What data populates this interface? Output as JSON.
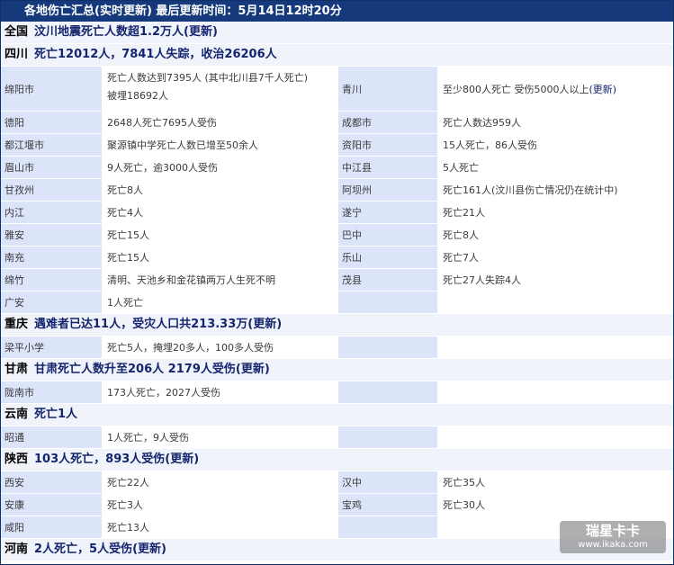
{
  "title": "各地伤亡汇总(实时更新) 最后更新时间：5月14日12时20分",
  "update_label": "(更新)",
  "sections": [
    {
      "province": "全国",
      "headline": "汶川地震死亡人数超1.2万人",
      "has_update": true,
      "rows": []
    },
    {
      "province": "四川",
      "headline": "死亡12012人，7841人失踪，收治26206人",
      "has_update": false,
      "rows": [
        {
          "l1": "绵阳市",
          "v1": "死亡人数达到7395人 (其中北川县7千人死亡)\n被埋18692人",
          "l2": "青川",
          "v2": "至少800人死亡 受伤5000人以上",
          "v2_update": "(更新)",
          "tall": true
        },
        {
          "l1": "德阳",
          "v1": "2648人死亡7695人受伤",
          "l2": "成都市",
          "v2": "死亡人数达959人"
        },
        {
          "l1": "都江堰市",
          "v1": "聚源镇中学死亡人数已增至50余人",
          "l2": "资阳市",
          "v2": "15人死亡，86人受伤"
        },
        {
          "l1": "眉山市",
          "v1": "9人死亡，逾3000人受伤",
          "l2": "中江县",
          "v2": "5人死亡"
        },
        {
          "l1": "甘孜州",
          "v1": "死亡8人",
          "l2": "阿坝州",
          "v2": "死亡161人(汶川县伤亡情况仍在统计中)"
        },
        {
          "l1": "内江",
          "v1": "死亡4人",
          "l2": "遂宁",
          "v2": "死亡21人"
        },
        {
          "l1": "雅安",
          "v1": "死亡15人",
          "l2": "巴中",
          "v2": "死亡8人"
        },
        {
          "l1": "南充",
          "v1": "死亡15人",
          "l2": "乐山",
          "v2": "死亡7人"
        },
        {
          "l1": "绵竹",
          "v1": "清明、天池乡和金花镇两万人生死不明",
          "l2": "茂县",
          "v2": "死亡27人失踪4人"
        },
        {
          "l1": "广安",
          "v1": "1人死亡",
          "l2": "",
          "v2": ""
        }
      ]
    },
    {
      "province": "重庆",
      "headline": "遇难者已达11人，受灾人口共213.33万",
      "has_update": true,
      "rows": [
        {
          "l1": "梁平小学",
          "v1": "死亡5人，掩埋20多人，100多人受伤",
          "l2": "",
          "v2": ""
        }
      ]
    },
    {
      "province": "甘肃",
      "headline": "甘肃死亡人数升至206人 2179人受伤",
      "has_update": true,
      "rows": [
        {
          "l1": "陇南市",
          "v1": "173人死亡，2027人受伤",
          "l2": "",
          "v2": ""
        }
      ]
    },
    {
      "province": "云南",
      "headline": "死亡1人",
      "has_update": false,
      "rows": [
        {
          "l1": "昭通",
          "v1": "1人死亡，9人受伤",
          "l2": "",
          "v2": ""
        }
      ]
    },
    {
      "province": "陕西",
      "headline": "103人死亡，893人受伤",
      "has_update": true,
      "rows": [
        {
          "l1": "西安",
          "v1": "死亡22人",
          "l2": "汉中",
          "v2": "死亡35人"
        },
        {
          "l1": "安康",
          "v1": "死亡3人",
          "l2": "宝鸡",
          "v2": "死亡30人"
        },
        {
          "l1": "咸阳",
          "v1": "死亡13人",
          "l2": "",
          "v2": ""
        }
      ]
    },
    {
      "province": "河南",
      "headline": "2人死亡，5人受伤",
      "has_update": true,
      "rows": []
    }
  ],
  "watermark": {
    "brand": "瑞星卡卡",
    "url": "www.ikaka.com"
  }
}
